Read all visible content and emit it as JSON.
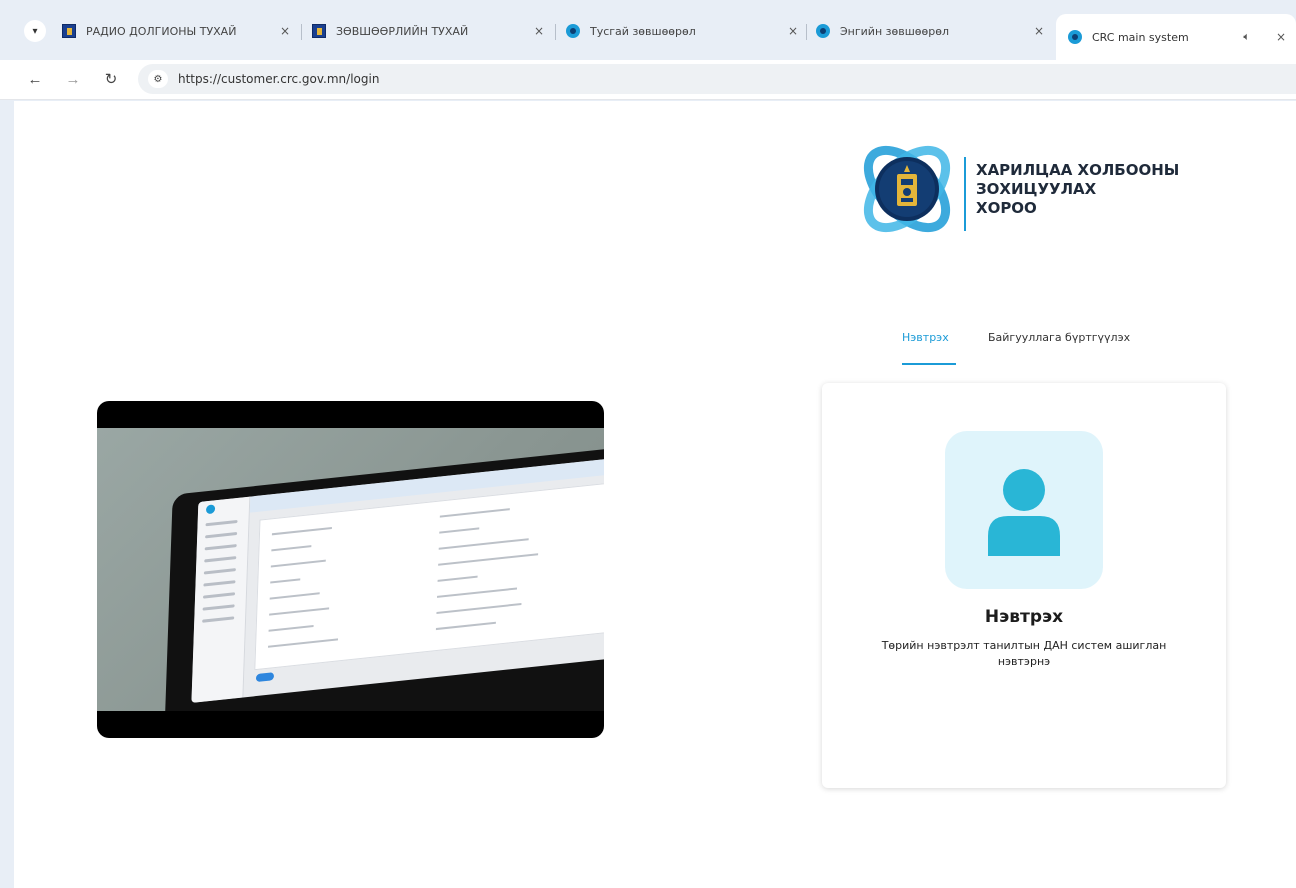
{
  "browser": {
    "tabs": [
      {
        "title": "РАДИО ДОЛГИОНЫ ТУХАЙ",
        "favicon": "flag-icon"
      },
      {
        "title": "ЗӨВШӨӨРЛИЙН ТУХАЙ",
        "favicon": "flag-icon"
      },
      {
        "title": "Тусгай зөвшөөрөл",
        "favicon": "crc-icon"
      },
      {
        "title": "Энгийн зөвшөөрөл",
        "favicon": "crc-icon"
      },
      {
        "title": "CRC main system",
        "favicon": "crc-icon",
        "active": true,
        "audio": "speaker-icon"
      }
    ],
    "tab_close": "×",
    "url": "https://customer.crc.gov.mn/login"
  },
  "logo": {
    "lines": [
      "ХАРИЛЦАА ХОЛБООНЫ",
      "ЗОХИЦУУЛАХ",
      "ХОРОО"
    ]
  },
  "login_tabs": {
    "login": "Нэвтрэх",
    "register": "Байгууллага бүртгүүлэх"
  },
  "login_card": {
    "title": "Нэвтрэх",
    "description": "Төрийн нэвтрэлт танилтын ДАН систем ашиглан нэвтэрнэ"
  },
  "colors": {
    "accent": "#1b9bd7",
    "avatar_bg": "#dff4fb",
    "avatar_fg": "#29b6d6",
    "chrome_bg": "#e8eef6"
  }
}
